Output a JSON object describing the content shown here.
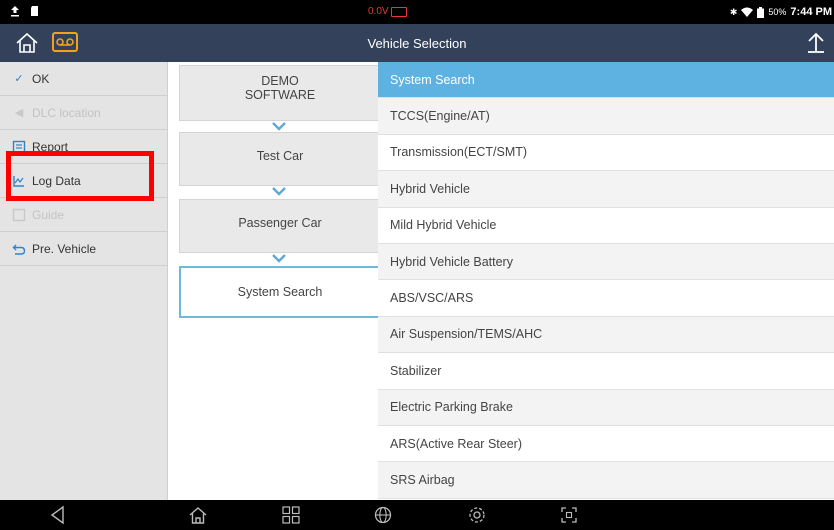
{
  "status_bar": {
    "voltage": "0.0V",
    "battery_percent": "50%",
    "time": "7:44 PM"
  },
  "title_bar": {
    "title": "Vehicle Selection"
  },
  "left_menu": {
    "items": [
      {
        "label": "OK",
        "icon": "check-icon",
        "enabled": true
      },
      {
        "label": "DLC location",
        "icon": "dlc-icon",
        "enabled": false
      },
      {
        "label": "Report",
        "icon": "report-icon",
        "enabled": true
      },
      {
        "label": "Log Data",
        "icon": "log-data-icon",
        "enabled": true
      },
      {
        "label": "Guide",
        "icon": "guide-icon",
        "enabled": false
      },
      {
        "label": "Pre. Vehicle",
        "icon": "back-arrow-icon",
        "enabled": true
      }
    ]
  },
  "breadcrumb": {
    "items": [
      {
        "label": "DEMO\nSOFTWARE"
      },
      {
        "label": "Test Car"
      },
      {
        "label": "Passenger Car"
      },
      {
        "label": "System Search",
        "active": true
      }
    ]
  },
  "system_list": {
    "selected": "System Search",
    "items": [
      "System Search",
      "TCCS(Engine/AT)",
      "Transmission(ECT/SMT)",
      "Hybrid Vehicle",
      "Mild Hybrid Vehicle",
      "Hybrid Vehicle Battery",
      "ABS/VSC/ARS",
      "Air Suspension/TEMS/AHC",
      "Stabilizer",
      "Electric Parking Brake",
      "ARS(Active Rear Steer)",
      "SRS Airbag"
    ]
  },
  "colors": {
    "title_bar": "#33425a",
    "selected_row": "#5db2e2",
    "accent": "#2f83c8",
    "highlight": "#ff0000"
  }
}
